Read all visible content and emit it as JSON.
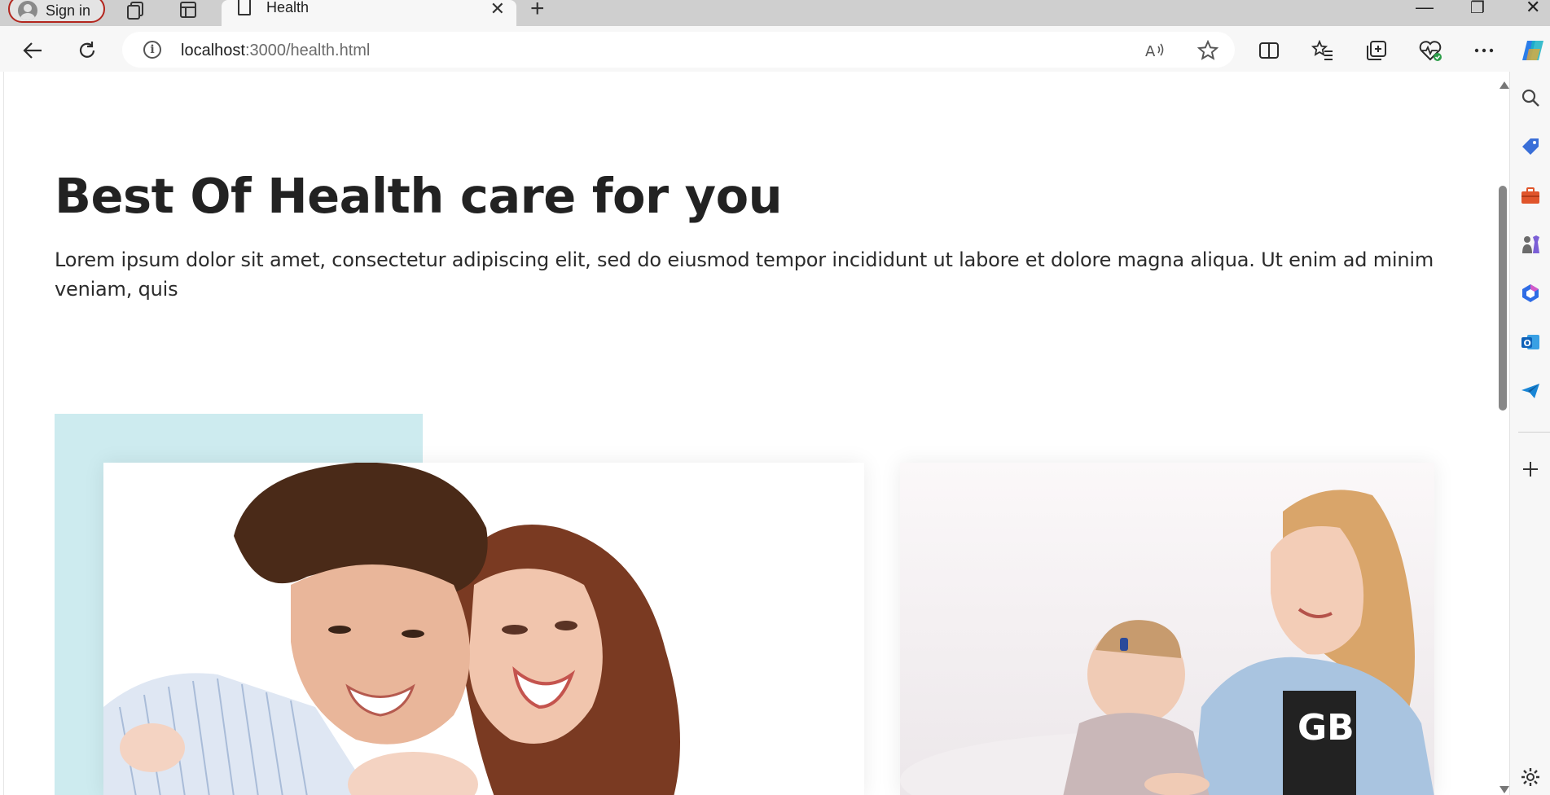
{
  "browser": {
    "sign_in_label": "Sign in",
    "tab_title": "Health",
    "url_host": "localhost",
    "url_rest": ":3000/health.html"
  },
  "page": {
    "title": "Best Of Health care for you",
    "description": "Lorem ipsum dolor sit amet, consectetur adipiscing elit, sed do eiusmod tempor incididunt ut labore et dolore magna aliqua. Ut enim ad minim veniam, quis"
  },
  "colors": {
    "accent_block": "#cdebef",
    "heading": "#222222",
    "signin_border": "#b3261e"
  },
  "icons": {
    "back": "back-arrow-icon",
    "refresh": "refresh-icon",
    "read_aloud": "read-aloud-icon",
    "favorite": "star-icon",
    "split": "split-screen-icon",
    "favorites": "favorites-icon",
    "collections": "collections-icon",
    "health": "browser-essentials-icon",
    "more": "more-icon",
    "copilot": "copilot-icon"
  }
}
